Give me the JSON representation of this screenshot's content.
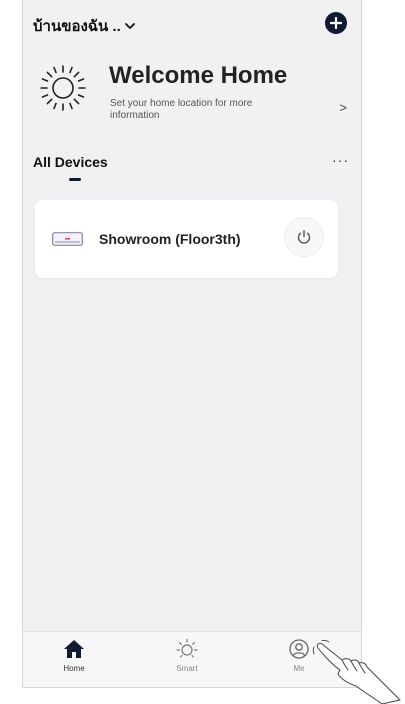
{
  "header": {
    "home_name": "บ้านของฉัน ..",
    "add_icon": "plus-circle-icon"
  },
  "welcome": {
    "icon": "sun-icon",
    "title": "Welcome Home",
    "subtitle": "Set your home location for more information",
    "arrow": ">"
  },
  "devices_section": {
    "tab_label": "All Devices",
    "more_label": "···"
  },
  "devices": [
    {
      "icon": "air-conditioner-icon",
      "name": "Showroom (Floor3th)",
      "power_icon": "power-icon"
    }
  ],
  "bottom_nav": {
    "items": [
      {
        "label": "Home",
        "icon": "home-icon",
        "active": true
      },
      {
        "label": "Smart",
        "icon": "sun-icon",
        "active": false
      },
      {
        "label": "Me",
        "icon": "user-icon",
        "active": false
      }
    ]
  },
  "colors": {
    "accent": "#101a33",
    "background": "#f1f1f3",
    "card": "#ffffff"
  }
}
